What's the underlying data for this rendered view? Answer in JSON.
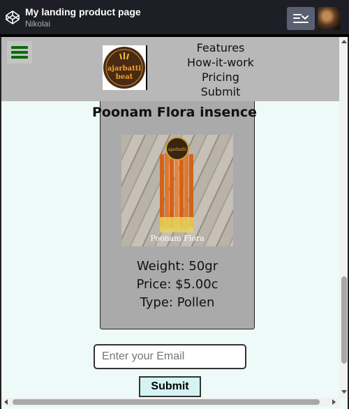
{
  "codepen": {
    "title": "My landing product page",
    "author": "Nikolai",
    "icons": [
      "codepen-logo-icon",
      "layout-icon",
      "avatar"
    ]
  },
  "nav": {
    "menu_icon": "hamburger-icon",
    "logo_text_top": "ajarbatti",
    "logo_text_bottom": "beat",
    "links": [
      "Features",
      "How-it-work",
      "Pricing",
      "Submit"
    ]
  },
  "product": {
    "name": "Poonam Flora insence",
    "image_caption": "Poonam Flora",
    "weight": "Weight: 50gr",
    "price": "Price: $5.00c",
    "type": "Type: Pollen"
  },
  "form": {
    "email_placeholder": "Enter your Email",
    "submit_label": "Submit"
  },
  "colors": {
    "nav_bg": "#b8b8b8",
    "card_bg": "#aaaaaa",
    "page_bg": "#eefaf8",
    "hamburger": "#0a6b0a",
    "submit_bg": "#d6f3f3"
  }
}
